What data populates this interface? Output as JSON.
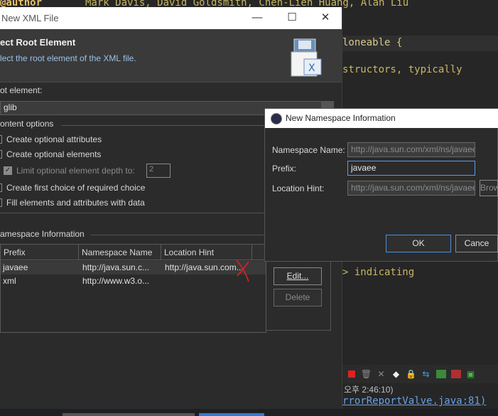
{
  "editor": {
    "author_tag": "@author",
    "authors": "Mark Davis, David Goldsmith, Chen-Lieh Huang, Alan Liu",
    "cloneable": "loneable {",
    "constructors": "structors, typically",
    "indicating": "> indicating",
    "console_time": "오후 2:46:10)",
    "console_link": "rrorReportValve.java:81)"
  },
  "wizard": {
    "title": "New XML File",
    "heading": "ect Root Element",
    "description": "lect the root element of the XML file.",
    "root_label": "ot element:",
    "root_value": "glib",
    "content_options_legend": "ontent options",
    "opt_attributes": "Create optional attributes",
    "opt_elements": "Create optional elements",
    "opt_limit_depth": "Limit optional element depth to:",
    "depth_value": "2",
    "opt_first_choice": "Create first choice of required choice",
    "opt_fill_data": "Fill elements and attributes with data",
    "ns_legend": "amespace Information",
    "table": {
      "columns": [
        "Prefix",
        "Namespace Name",
        "Location Hint"
      ],
      "rows": [
        {
          "prefix": "javaee",
          "namespace": "http://java.sun.c...",
          "hint": "http://java.sun.com..."
        },
        {
          "prefix": "xml",
          "namespace": "http://www.w3.o...",
          "hint": ""
        }
      ]
    },
    "edit_button": "Edit...",
    "delete_button": "Delete"
  },
  "ns_dialog": {
    "title": "New Namespace Information",
    "name_label": "Namespace Name:",
    "name_value": "http://java.sun.com/xml/ns/javaee",
    "prefix_label": "Prefix:",
    "prefix_value": "javaee",
    "hint_label": "Location Hint:",
    "hint_value": "http://java.sun.com/xml/ns/javaee",
    "browse_button": "Brow",
    "ok_button": "OK",
    "cancel_button": "Cance"
  },
  "colors": {
    "accent": "#2f7bd1",
    "dark_bg": "#2b2b2b"
  }
}
